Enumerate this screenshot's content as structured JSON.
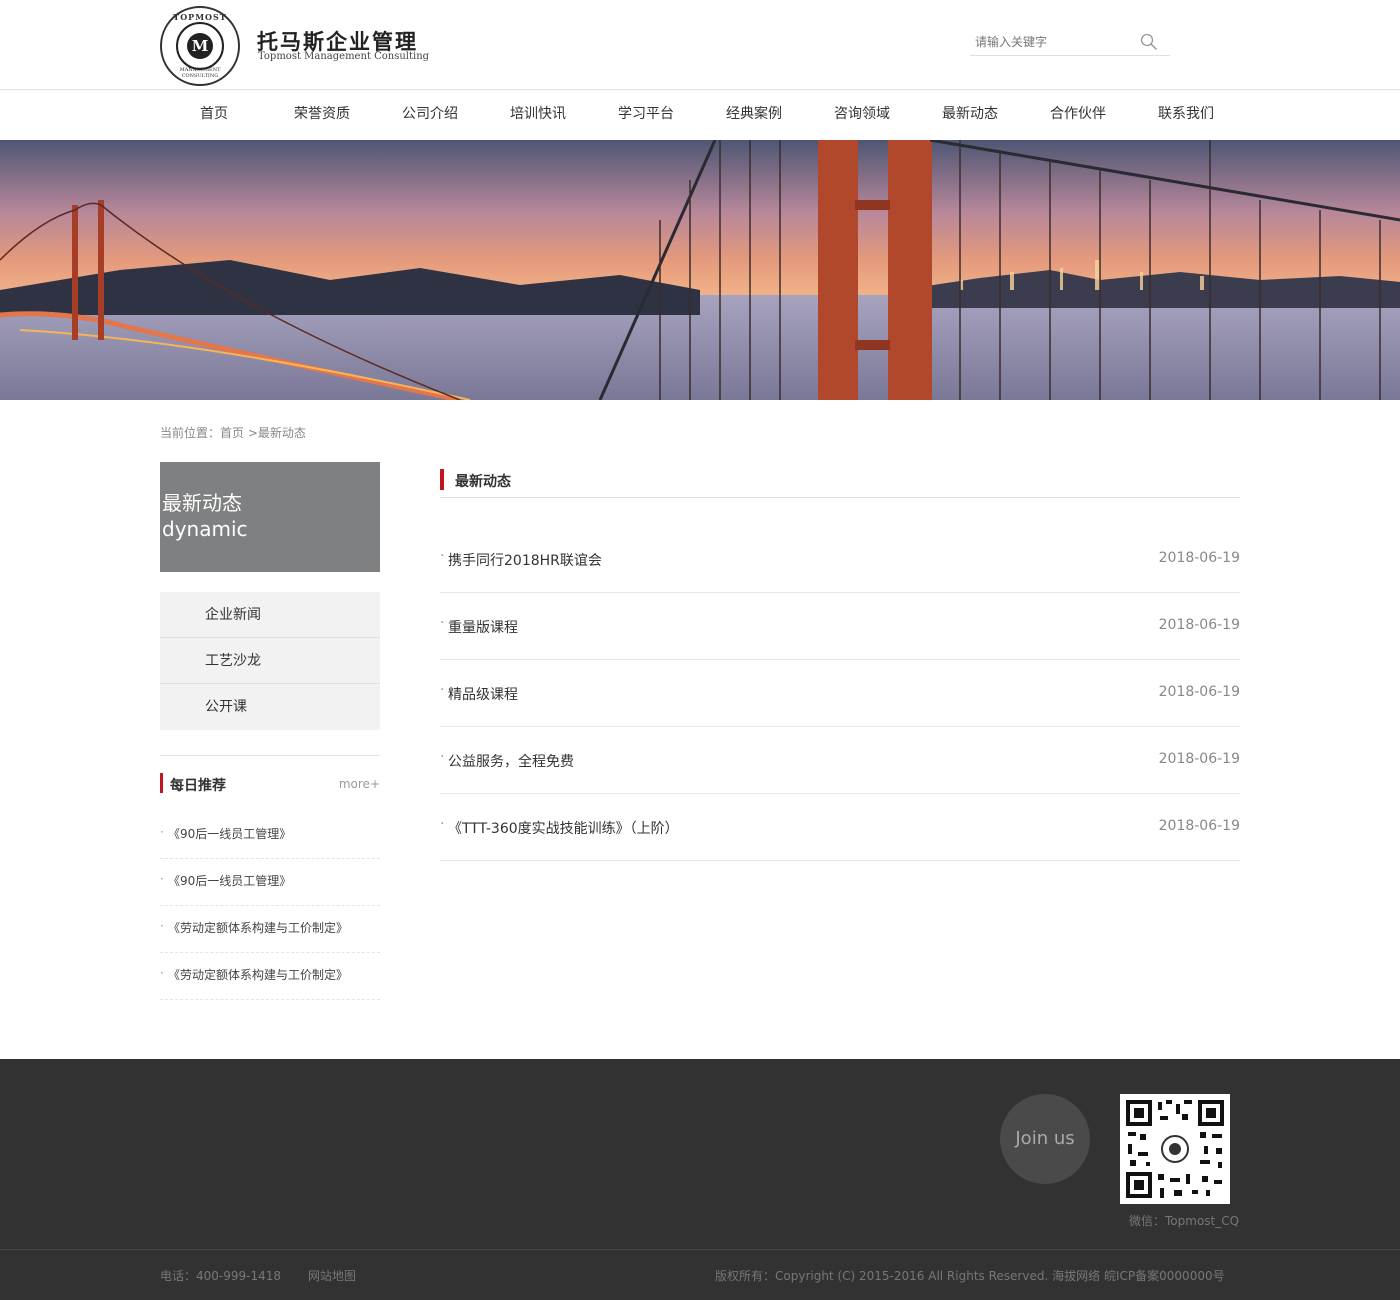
{
  "header": {
    "logo_cn": "托马斯企业管理",
    "logo_en": "Topmost Management Consulting",
    "seal_top": "TOPMOST",
    "seal_bottom": "MANAGEMENT CONSULTING",
    "seal_letter": "M",
    "search_placeholder": "请输入关键字"
  },
  "nav": [
    "首页",
    "荣誉资质",
    "公司介绍",
    "培训快讯",
    "学习平台",
    "经典案例",
    "咨询领域",
    "最新动态",
    "合作伙伴",
    "联系我们"
  ],
  "breadcrumb": "当前位置：首页 >最新动态",
  "sidebar": {
    "title_cn": "最新动态",
    "title_en": "dynamic",
    "menu": [
      "企业新闻",
      "工艺沙龙",
      "公开课"
    ],
    "recommend": {
      "title": "每日推荐",
      "more": "more+",
      "items": [
        "《90后一线员工管理》",
        "《90后一线员工管理》",
        "《劳动定额体系构建与工价制定》",
        "《劳动定额体系构建与工价制定》"
      ]
    }
  },
  "main": {
    "title": "最新动态",
    "news": [
      {
        "title": "携手同行2018HR联谊会",
        "date": "2018-06-19"
      },
      {
        "title": "重量版课程",
        "date": "2018-06-19"
      },
      {
        "title": "精品级课程",
        "date": "2018-06-19"
      },
      {
        "title": "公益服务，全程免费",
        "date": "2018-06-19"
      },
      {
        "title": "《TTT-360度实战技能训练》（上阶）",
        "date": "2018-06-19"
      }
    ]
  },
  "footer": {
    "join": "Join us",
    "wechat": "微信：Topmost_CQ",
    "phone": "电话：400-999-1418",
    "sitemap": "网站地图",
    "copyright": "版权所有：Copyright (C) 2015-2016 All Rights Reserved. 海拔网络",
    "icp": "皖ICP备案0000000号"
  },
  "colors": {
    "accent": "#c0161f",
    "sidebar_title_bg": "#7f8081",
    "footer_bg": "#323232"
  }
}
